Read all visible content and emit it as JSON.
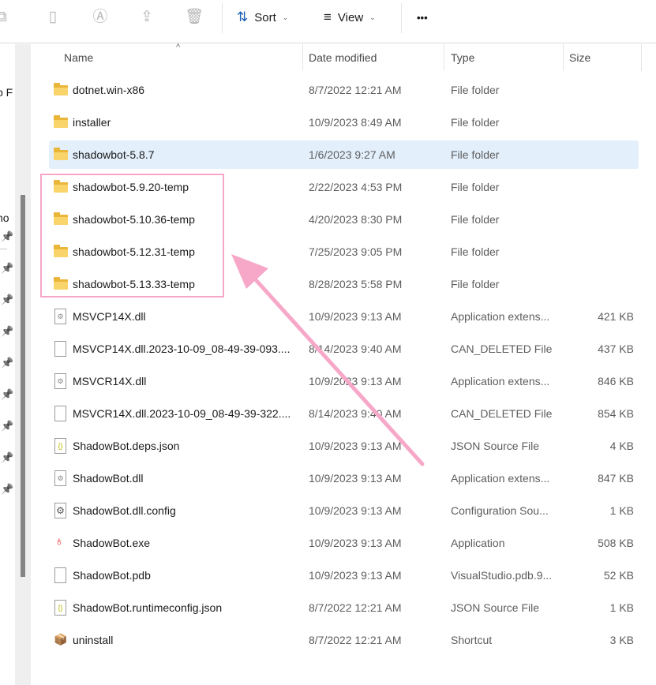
{
  "toolbar": {
    "sort_label": "Sort",
    "view_label": "View",
    "more_label": "•••"
  },
  "sidebar": {
    "partial_item_1": "p F",
    "partial_item_2": "no"
  },
  "columns": {
    "name": "Name",
    "date": "Date modified",
    "type": "Type",
    "size": "Size"
  },
  "files": [
    {
      "name": "dotnet.win-x86",
      "date": "8/7/2022 12:21 AM",
      "type": "File folder",
      "size": "",
      "icon": "folder"
    },
    {
      "name": "installer",
      "date": "10/9/2023 8:49 AM",
      "type": "File folder",
      "size": "",
      "icon": "folder"
    },
    {
      "name": "shadowbot-5.8.7",
      "date": "1/6/2023 9:27 AM",
      "type": "File folder",
      "size": "",
      "icon": "folder"
    },
    {
      "name": "shadowbot-5.9.20-temp",
      "date": "2/22/2023 4:53 PM",
      "type": "File folder",
      "size": "",
      "icon": "folder"
    },
    {
      "name": "shadowbot-5.10.36-temp",
      "date": "4/20/2023 8:30 PM",
      "type": "File folder",
      "size": "",
      "icon": "folder"
    },
    {
      "name": "shadowbot-5.12.31-temp",
      "date": "7/25/2023 9:05 PM",
      "type": "File folder",
      "size": "",
      "icon": "folder"
    },
    {
      "name": "shadowbot-5.13.33-temp",
      "date": "8/28/2023 5:58 PM",
      "type": "File folder",
      "size": "",
      "icon": "folder"
    },
    {
      "name": "MSVCP14X.dll",
      "date": "10/9/2023 9:13 AM",
      "type": "Application extens...",
      "size": "421 KB",
      "icon": "dll"
    },
    {
      "name": "MSVCP14X.dll.2023-10-09_08-49-39-093....",
      "date": "8/14/2023 9:40 AM",
      "type": "CAN_DELETED File",
      "size": "437 KB",
      "icon": "file"
    },
    {
      "name": "MSVCR14X.dll",
      "date": "10/9/2023 9:13 AM",
      "type": "Application extens...",
      "size": "846 KB",
      "icon": "dll"
    },
    {
      "name": "MSVCR14X.dll.2023-10-09_08-49-39-322....",
      "date": "8/14/2023 9:40 AM",
      "type": "CAN_DELETED File",
      "size": "854 KB",
      "icon": "file"
    },
    {
      "name": "ShadowBot.deps.json",
      "date": "10/9/2023 9:13 AM",
      "type": "JSON Source File",
      "size": "4 KB",
      "icon": "json"
    },
    {
      "name": "ShadowBot.dll",
      "date": "10/9/2023 9:13 AM",
      "type": "Application extens...",
      "size": "847 KB",
      "icon": "dll"
    },
    {
      "name": "ShadowBot.dll.config",
      "date": "10/9/2023 9:13 AM",
      "type": "Configuration Sou...",
      "size": "1 KB",
      "icon": "config"
    },
    {
      "name": "ShadowBot.exe",
      "date": "10/9/2023 9:13 AM",
      "type": "Application",
      "size": "508 KB",
      "icon": "exe"
    },
    {
      "name": "ShadowBot.pdb",
      "date": "10/9/2023 9:13 AM",
      "type": "VisualStudio.pdb.9...",
      "size": "52 KB",
      "icon": "file"
    },
    {
      "name": "ShadowBot.runtimeconfig.json",
      "date": "8/7/2022 12:21 AM",
      "type": "JSON Source File",
      "size": "1 KB",
      "icon": "json"
    },
    {
      "name": "uninstall",
      "date": "8/7/2022 12:21 AM",
      "type": "Shortcut",
      "size": "3 KB",
      "icon": "shortcut"
    }
  ],
  "selected_index": 2,
  "colors": {
    "highlight": "#f6a6c6",
    "selection": "#e3effb",
    "folder": "#f8d46a"
  }
}
